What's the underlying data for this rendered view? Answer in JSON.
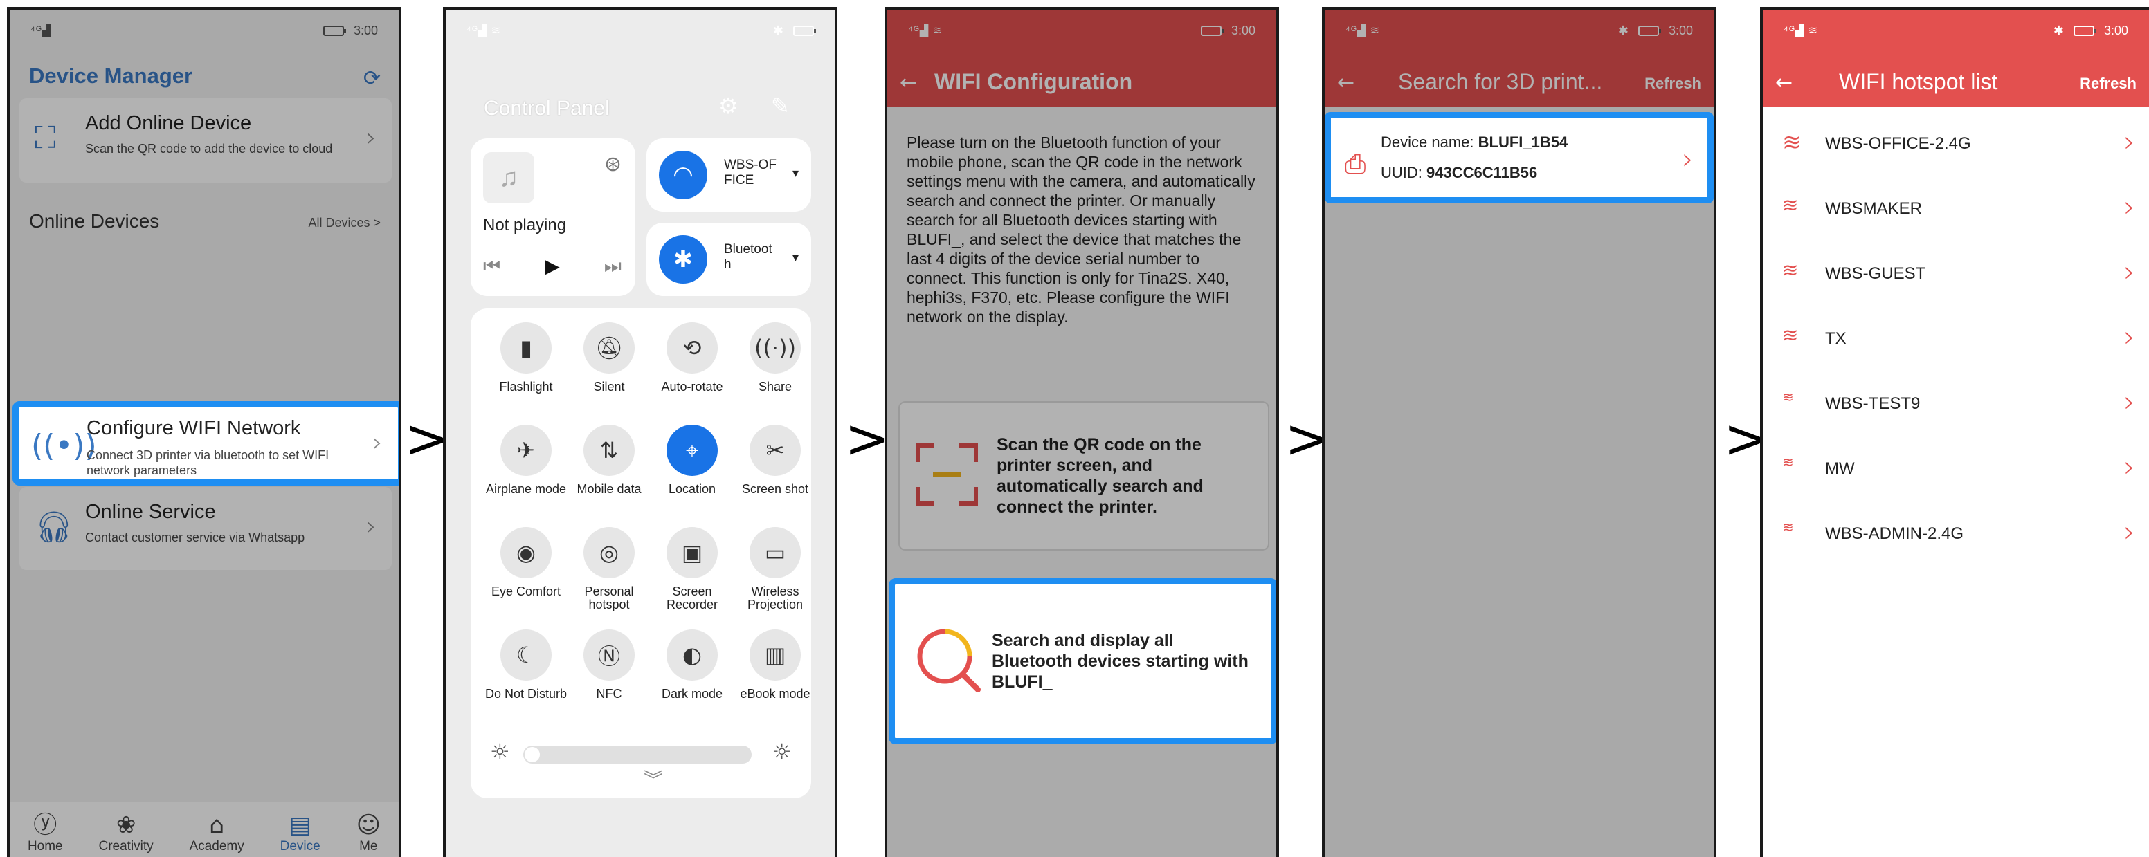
{
  "colors": {
    "accent_blue": "#1e8ef2",
    "brand_red": "#e3504f",
    "device_blue": "#3a78c2"
  },
  "separator": ">",
  "screen1": {
    "status_time": "3:00",
    "title": "Device Manager",
    "add_device": {
      "title": "Add Online Device",
      "desc": "Scan the QR code to add the device to cloud"
    },
    "online_devices": "Online Devices",
    "all_devices": "All Devices >",
    "configure_wifi": {
      "title": "Configure WIFI Network",
      "desc": "Connect 3D printer via bluetooth to set WIFI network parameters"
    },
    "online_service": {
      "title": "Online Service",
      "desc": "Contact customer service via Whatsapp"
    },
    "tabs": [
      "Home",
      "Creativity",
      "Academy",
      "Device",
      "Me"
    ],
    "active_tab": "Device"
  },
  "screen2": {
    "title": "Control Panel",
    "music": {
      "status": "Not playing"
    },
    "wifi_tile": "WBS-OF FICE",
    "bt_tile": "Bluetoot h",
    "toggles": [
      {
        "label": "Flashlight",
        "icon": "flashlight-icon"
      },
      {
        "label": "Silent",
        "icon": "bell-off-icon"
      },
      {
        "label": "Auto-rotate",
        "icon": "rotate-icon"
      },
      {
        "label": "Share",
        "icon": "share-icon"
      },
      {
        "label": "Airplane mode",
        "icon": "airplane-icon"
      },
      {
        "label": "Mobile data",
        "icon": "data-icon"
      },
      {
        "label": "Location",
        "icon": "location-icon"
      },
      {
        "label": "Screen shot",
        "icon": "scissors-icon"
      },
      {
        "label": "Eye Comfort",
        "icon": "eye-icon"
      },
      {
        "label": "Personal hotspot",
        "icon": "hotspot-icon"
      },
      {
        "label": "Screen Recorder",
        "icon": "camera-icon"
      },
      {
        "label": "Wireless Projection",
        "icon": "projection-icon"
      },
      {
        "label": "Do Not Disturb",
        "icon": "moon-icon"
      },
      {
        "label": "NFC",
        "icon": "nfc-icon"
      },
      {
        "label": "Dark mode",
        "icon": "dark-mode-icon"
      },
      {
        "label": "eBook mode",
        "icon": "book-icon"
      }
    ],
    "location_enabled": true
  },
  "screen3": {
    "status_time": "3:00",
    "title": "WIFI Configuration",
    "instructions": "Please turn on the Bluetooth function of your mobile phone, scan the QR code in the network settings menu with the camera, and automatically search and connect the printer. Or manually search for all Bluetooth devices starting with BLUFI_, and select the device that matches the last 4 digits of the device serial number to connect. This function is only for Tina2S. X40, hephi3s, F370, etc. Please configure the WIFI network on the display.",
    "scan_option": "Scan the QR code on the printer screen, and automatically search and connect the printer.",
    "search_option": "Search and display all Bluetooth devices starting with BLUFI_"
  },
  "screen4": {
    "status_time": "3:00",
    "title": "Search for 3D print...",
    "refresh": "Refresh",
    "device_name_label": "Device name: ",
    "device_name": "BLUFI_1B54",
    "uuid_label": "UUID: ",
    "uuid": "943CC6C11B56"
  },
  "screen5": {
    "status_time": "3:00",
    "title": "WIFI hotspot list",
    "refresh": "Refresh",
    "networks": [
      {
        "name": "WBS-OFFICE-2.4G",
        "strength": "high"
      },
      {
        "name": "WBSMAKER",
        "strength": "medium"
      },
      {
        "name": "WBS-GUEST",
        "strength": "medium"
      },
      {
        "name": "TX",
        "strength": "medium"
      },
      {
        "name": "WBS-TEST9",
        "strength": "low"
      },
      {
        "name": "MW",
        "strength": "low"
      },
      {
        "name": "WBS-ADMIN-2.4G",
        "strength": "low"
      }
    ]
  }
}
